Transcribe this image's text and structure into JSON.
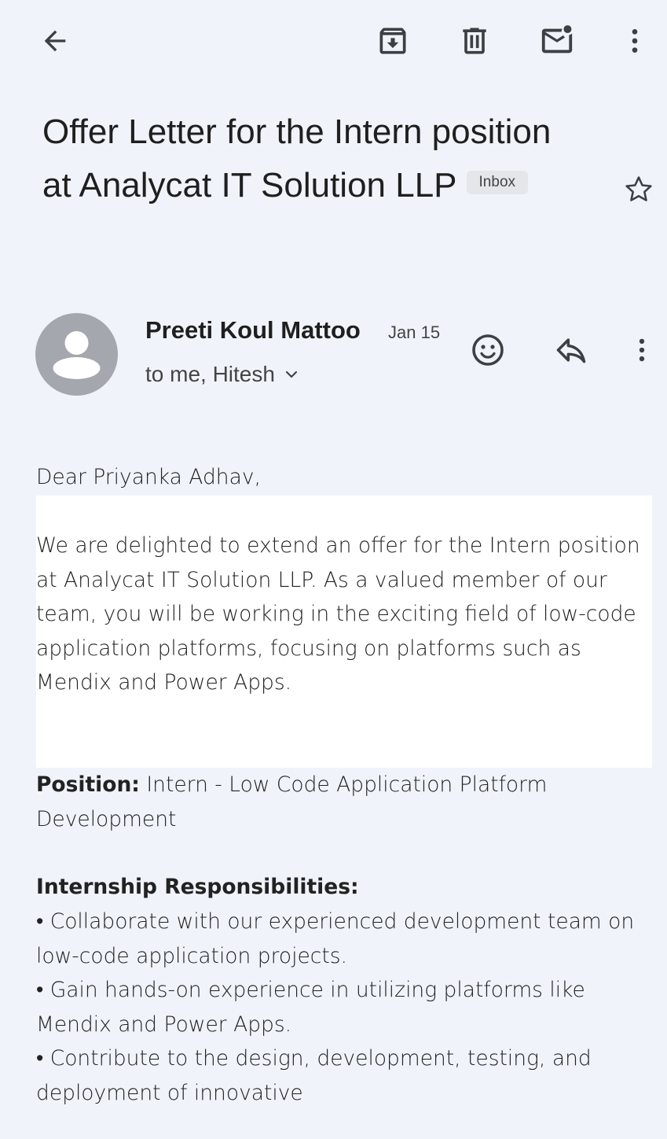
{
  "toolbar": {
    "icons": [
      "back-arrow-icon",
      "archive-icon",
      "delete-icon",
      "mark-unread-icon",
      "more-vert-icon"
    ]
  },
  "email": {
    "subject": "Offer Letter for the Intern position at Analycat IT Solution LLP",
    "label_chip": "Inbox",
    "sender_name": "Preeti Koul Mattoo",
    "date": "Jan 15",
    "recipients": "to me, Hitesh"
  },
  "body": {
    "greeting": "Dear Priyanka Adhav,",
    "intro": "We are delighted to extend an offer for the Intern position at Analycat IT Solution LLP. As a valued member of our team, you will be working in the exciting field of low-code application platforms, focusing on platforms such as Mendix and Power Apps.",
    "position_label": "Position:",
    "position_value": " Intern - Low Code Application Platform Development",
    "responsibilities_heading": "Internship Responsibilities:",
    "bullets": [
      "• Collaborate with our experienced development team on low-code application projects.",
      "• Gain hands-on experience in utilizing platforms like Mendix and Power Apps.",
      "• Contribute to the design, development, testing, and deployment of innovative"
    ]
  }
}
